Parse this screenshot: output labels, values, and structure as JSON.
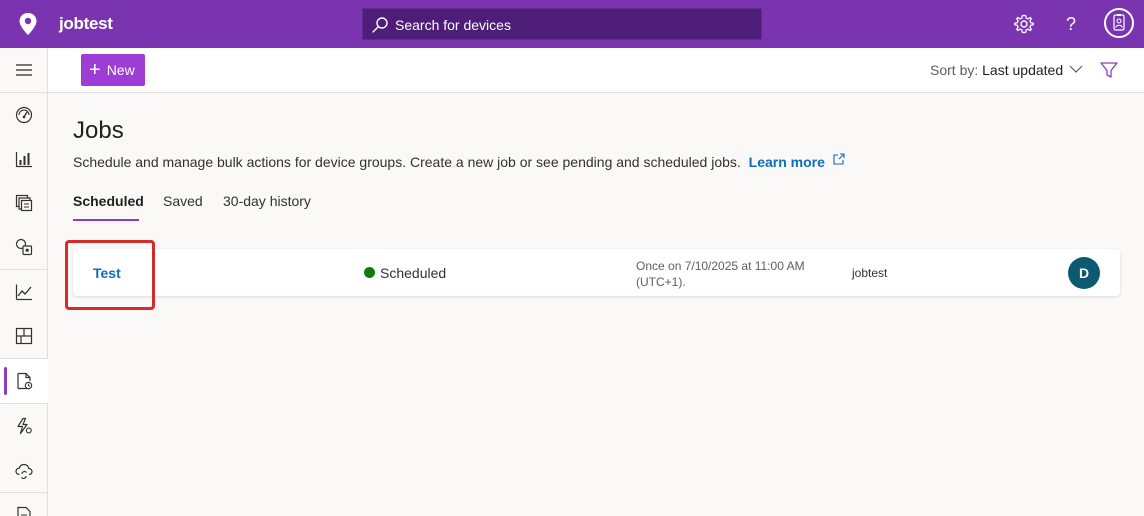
{
  "header": {
    "app_name": "jobtest",
    "search_placeholder": "Search for devices",
    "help_label": "?"
  },
  "sidebar": {
    "items": [
      {
        "name": "menu"
      },
      {
        "name": "dashboard"
      },
      {
        "name": "devices"
      },
      {
        "name": "device-groups"
      },
      {
        "name": "rules"
      },
      {
        "name": "analytics"
      },
      {
        "name": "dashboards"
      },
      {
        "name": "jobs",
        "active": true
      },
      {
        "name": "device-templates"
      },
      {
        "name": "data-export"
      },
      {
        "name": "administration"
      }
    ]
  },
  "toolbar": {
    "new_label": "New",
    "sort_label": "Sort by:",
    "sort_value": "Last updated"
  },
  "page": {
    "title": "Jobs",
    "description": "Schedule and manage bulk actions for device groups. Create a new job or see pending and scheduled jobs.",
    "learn_more": "Learn more"
  },
  "tabs": [
    {
      "label": "Scheduled",
      "active": true
    },
    {
      "label": "Saved"
    },
    {
      "label": "30-day history"
    }
  ],
  "jobs": [
    {
      "name": "Test",
      "status": "Scheduled",
      "schedule_line1": "Once on 7/10/2025 at 11:00 AM",
      "schedule_line2": "(UTC+1).",
      "application": "jobtest",
      "owner_initial": "D"
    }
  ],
  "colors": {
    "header": "#7b34b0",
    "accent": "#8a3dc6",
    "new_button": "#9e3dd6",
    "link": "#0f6cbd",
    "status_scheduled": "#107c10",
    "owner_avatar": "#0b5a71",
    "highlight": "#d42b2b"
  }
}
